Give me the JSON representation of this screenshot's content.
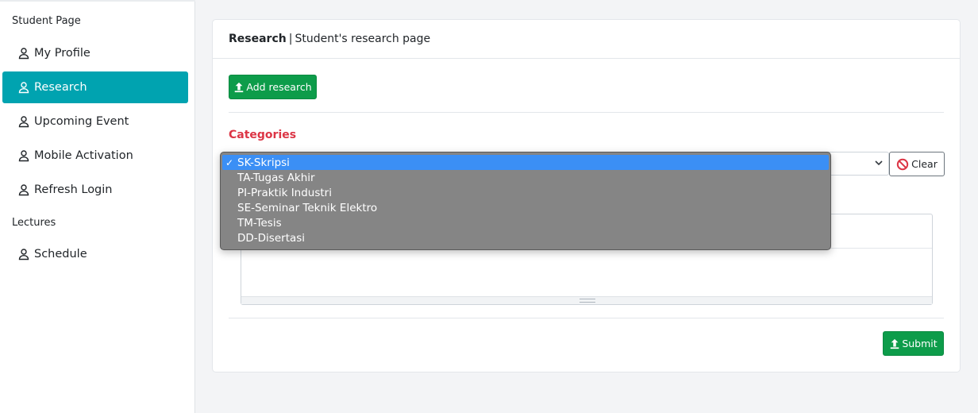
{
  "sidebar": {
    "section_student": "Student Page",
    "section_lectures": "Lectures",
    "items": [
      {
        "label": "My Profile"
      },
      {
        "label": "Research"
      },
      {
        "label": "Upcoming Event"
      },
      {
        "label": "Mobile Activation"
      },
      {
        "label": "Refresh Login"
      }
    ],
    "lecture_items": [
      {
        "label": "Schedule"
      }
    ],
    "active_item": "Research",
    "active_color": "#00a3b0"
  },
  "card": {
    "title": "Research",
    "separator": "|",
    "subtitle": "Student's research page",
    "add_button": "Add research",
    "categories_label": "Categories",
    "clear_button": "Clear",
    "submit_button": "Submit"
  },
  "dropdown": {
    "selected": "SK-Skripsi",
    "check_mark": "✓",
    "options": [
      "SK-Skripsi",
      "TA-Tugas Akhir",
      "PI-Praktik Industri",
      "SE-Seminar Teknik Elektro",
      "TM-Tesis",
      "DD-Disertasi"
    ]
  },
  "colors": {
    "button_green": "#0d9c4a",
    "label_red": "#dc3545",
    "highlight_blue": "#3b8ff5"
  }
}
